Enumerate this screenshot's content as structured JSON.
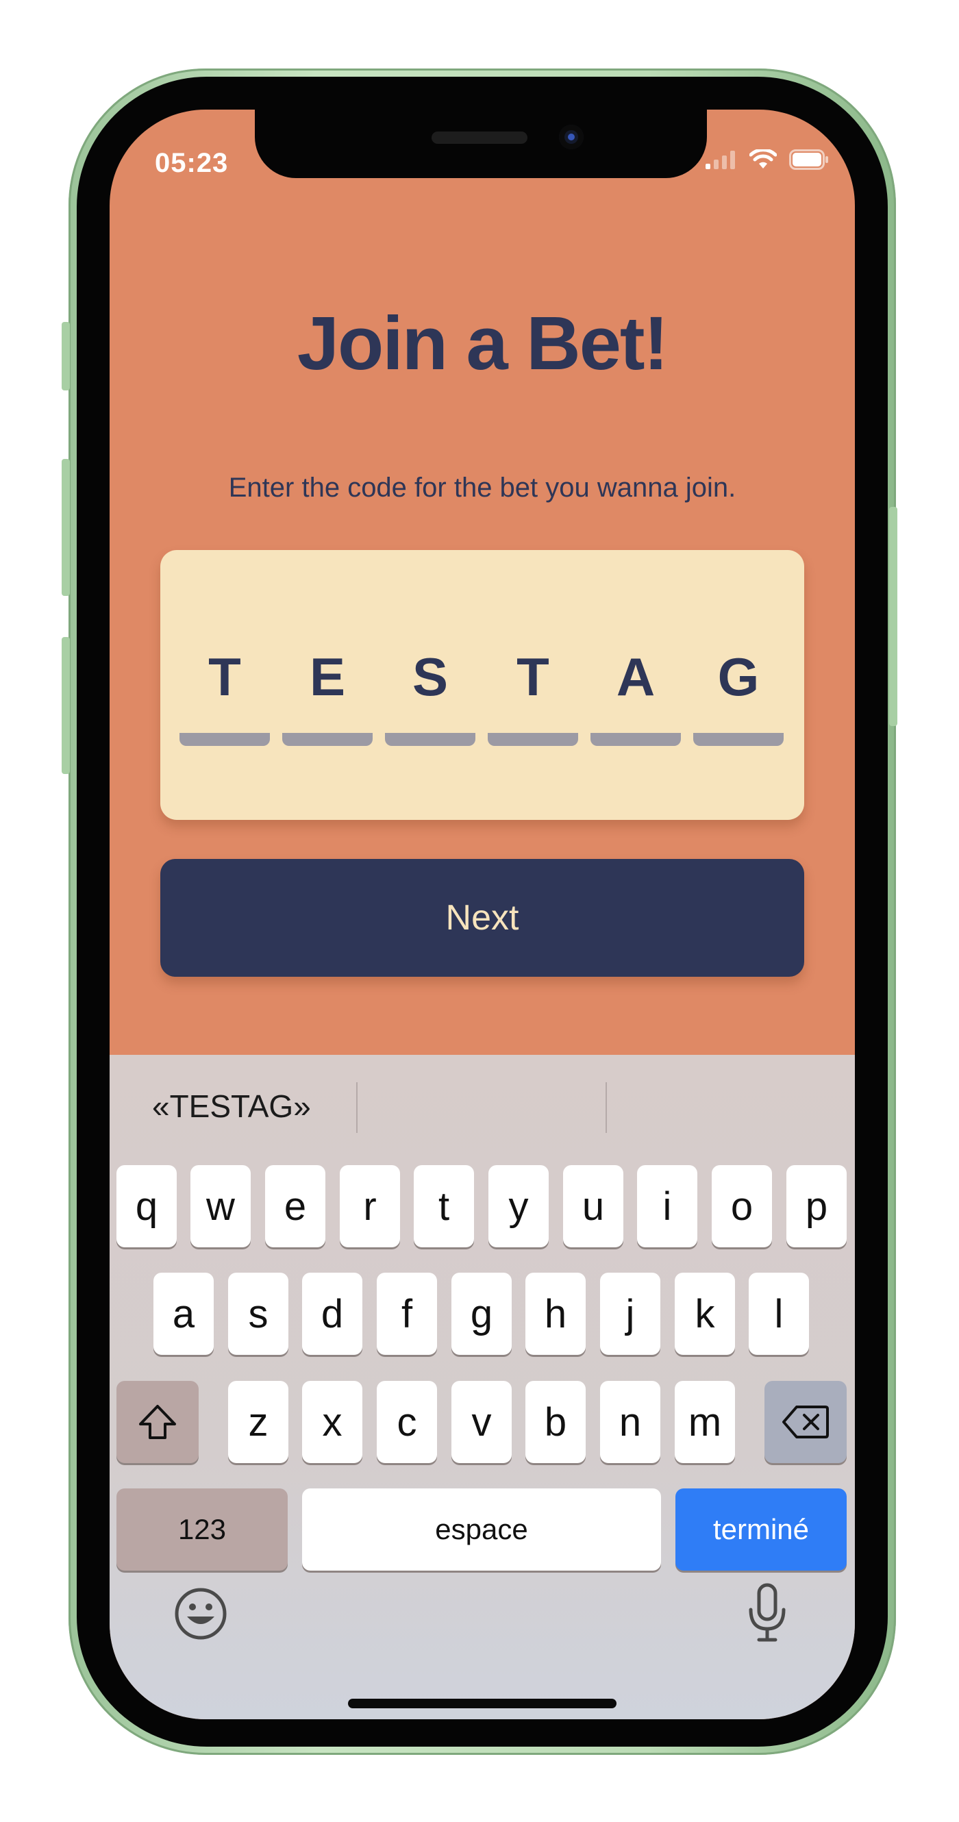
{
  "status_bar": {
    "time": "05:23",
    "signal_icon": "signal-bars-icon",
    "wifi_icon": "wifi-icon",
    "battery_icon": "battery-icon"
  },
  "screen": {
    "title": "Join a Bet!",
    "subtitle": "Enter the code for the bet you wanna join.",
    "code": [
      "T",
      "E",
      "S",
      "T",
      "A",
      "G"
    ],
    "next_label": "Next"
  },
  "keyboard": {
    "suggestions": [
      "«TESTAG»",
      "",
      ""
    ],
    "rows": [
      [
        "q",
        "w",
        "e",
        "r",
        "t",
        "y",
        "u",
        "i",
        "o",
        "p"
      ],
      [
        "a",
        "s",
        "d",
        "f",
        "g",
        "h",
        "j",
        "k",
        "l"
      ],
      [
        "z",
        "x",
        "c",
        "v",
        "b",
        "n",
        "m"
      ]
    ],
    "shift_icon": "shift-icon",
    "delete_icon": "delete-icon",
    "numbers_label": "123",
    "space_label": "espace",
    "done_label": "terminé",
    "emoji_icon": "emoji-icon",
    "mic_icon": "microphone-icon"
  },
  "colors": {
    "background": "#df8965",
    "card": "#f7e4bd",
    "accent": "#2e3657",
    "done_key": "#2f7df6"
  }
}
